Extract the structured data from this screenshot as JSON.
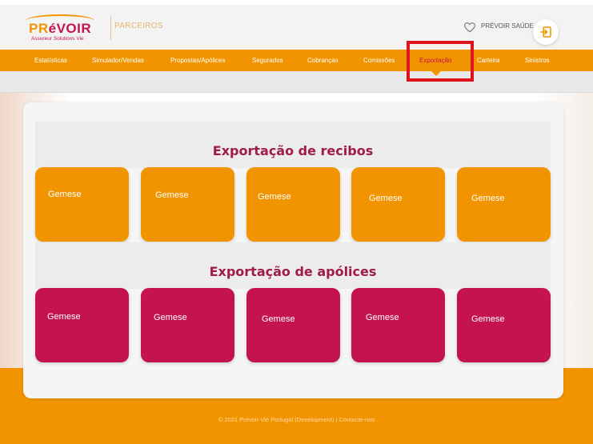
{
  "header": {
    "logo_text_orange": "PR",
    "logo_text_pink": "éVOIR",
    "logo_tagline": "Assureur Solutions Vie",
    "section_label": "PARCEIROS",
    "saude_label": "PRÉVOIR SAÚDE",
    "logout_icon": "logout-icon",
    "heart_icon": "heart-icon"
  },
  "nav": {
    "items": [
      {
        "label": "Estatísticas",
        "active": false
      },
      {
        "label": "Simulador/Vendas",
        "active": false
      },
      {
        "label": "Propostas/Apólices",
        "active": false
      },
      {
        "label": "Segurados",
        "active": false
      },
      {
        "label": "Cobranças",
        "active": false
      },
      {
        "label": "Comissões",
        "active": false
      },
      {
        "label": "Exportação",
        "active": true
      },
      {
        "label": "Carteira",
        "active": false
      },
      {
        "label": "Sinistros",
        "active": false
      }
    ]
  },
  "sections": [
    {
      "title": "Exportação de recibos",
      "tiles": [
        "Gemese",
        "Gemese",
        "Gemese",
        "Gemese",
        "Gemese"
      ]
    },
    {
      "title": "Exportação de apólices",
      "tiles": [
        "Gemese",
        "Gemese",
        "Gemese",
        "Gemese",
        "Gemese"
      ]
    }
  ],
  "footer": {
    "text": "© 2021 Prévoir-Vie Portugal (Development) | Contacte-nos"
  },
  "colors": {
    "brand_orange": "#f29400",
    "brand_pink": "#c5144d",
    "title_color": "#a01a4a",
    "highlight": "#e0141e"
  }
}
